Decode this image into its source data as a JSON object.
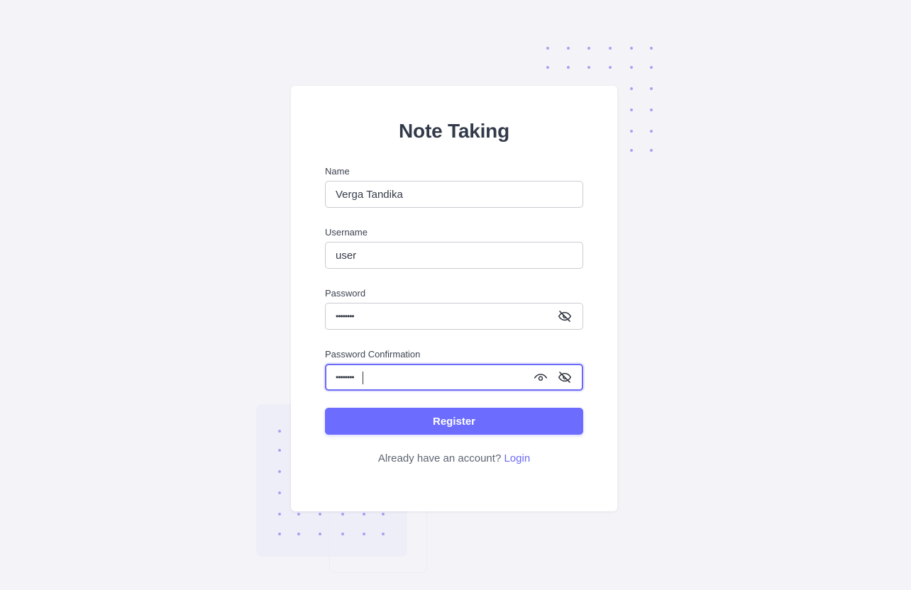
{
  "app": {
    "title": "Note Taking"
  },
  "form": {
    "name": {
      "label": "Name",
      "value": "Verga Tandika"
    },
    "username": {
      "label": "Username",
      "value": "user"
    },
    "password": {
      "label": "Password",
      "value": "••••••••"
    },
    "password_confirmation": {
      "label": "Password Confirmation",
      "value": "••••••••"
    },
    "submit_label": "Register"
  },
  "footer": {
    "prompt": "Already have an account?",
    "link_label": "Login"
  },
  "icons": {
    "password_toggle": "eye-off-icon",
    "confirmation_show": "eye-icon",
    "confirmation_toggle": "eye-off-icon"
  },
  "colors": {
    "accent": "#6c6cff",
    "link": "#6c69f6",
    "decorative_dots": "#a9a2f2",
    "background": "#f4f4f8"
  }
}
